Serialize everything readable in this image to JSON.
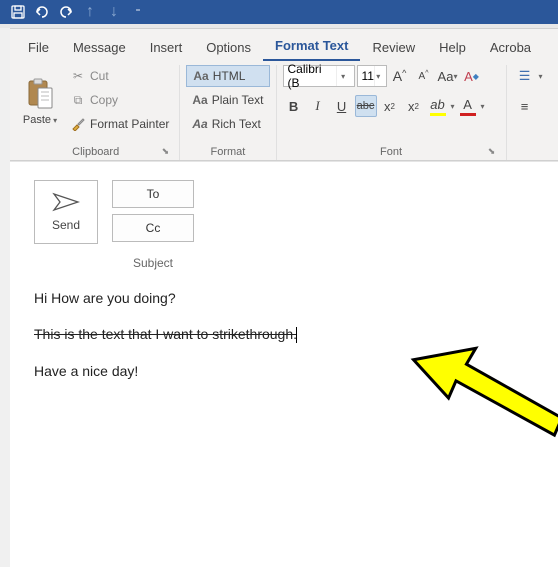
{
  "quickAccess": {
    "save": "Save",
    "undo": "Undo",
    "redo": "Redo"
  },
  "tabs": {
    "file": "File",
    "message": "Message",
    "insert": "Insert",
    "options": "Options",
    "formatText": "Format Text",
    "review": "Review",
    "help": "Help",
    "acrobat": "Acroba"
  },
  "ribbon": {
    "clipboard": {
      "label": "Clipboard",
      "paste": "Paste",
      "cut": "Cut",
      "copy": "Copy",
      "formatPainter": "Format Painter"
    },
    "format": {
      "label": "Format",
      "html": "HTML",
      "plain": "Plain Text",
      "rich": "Rich Text",
      "aa": "Aa"
    },
    "font": {
      "label": "Font",
      "fontName": "Calibri (B",
      "fontSize": "11",
      "bold": "B",
      "italic": "I",
      "underline": "U",
      "strike": "abc",
      "sub": "x",
      "sup": "x",
      "sub2": "2",
      "sup2": "2",
      "growA": "A",
      "shrinkA": "A",
      "changeCase": "Aa",
      "clear": "A",
      "highlight": "A",
      "fontColor": "A"
    }
  },
  "compose": {
    "send": "Send",
    "to": "To",
    "cc": "Cc",
    "subject": "Subject"
  },
  "body": {
    "line1": "Hi How are you doing?",
    "line2": "This is the text that I want to strikethrough.",
    "line3": "Have a nice day!"
  }
}
